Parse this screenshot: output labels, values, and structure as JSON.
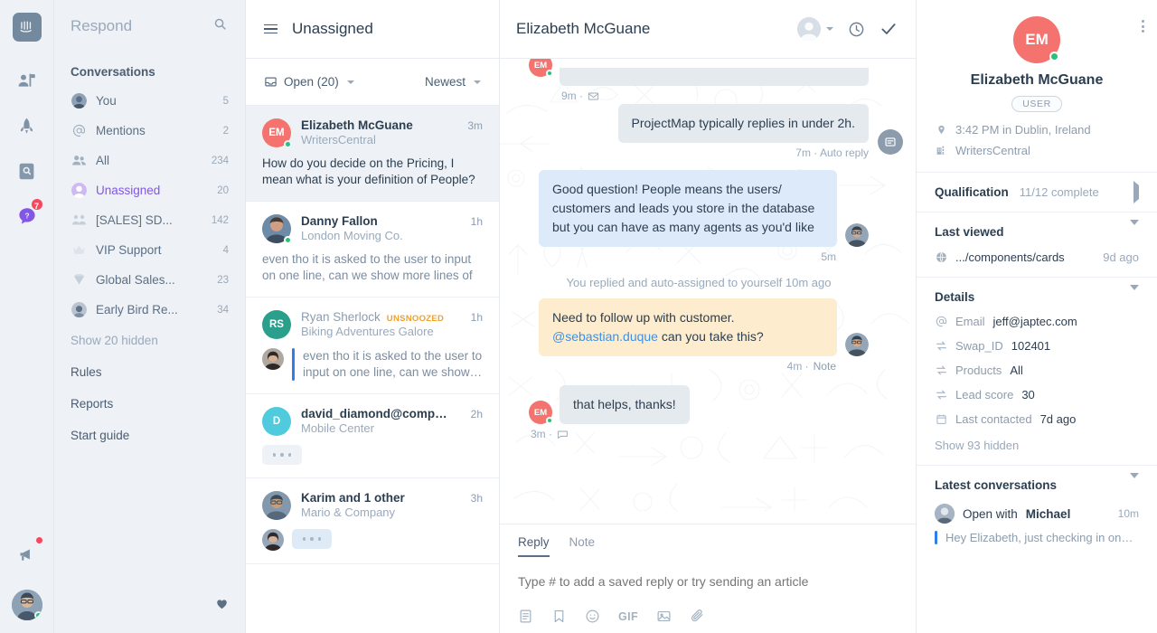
{
  "rail": {
    "logo_icon": "intercom-logo-icon",
    "items": [
      {
        "icon": "platform-people-icon",
        "name": "platform"
      },
      {
        "icon": "rocket-icon",
        "name": "outbound"
      },
      {
        "icon": "knowledge-base-icon",
        "name": "articles"
      },
      {
        "icon": "respond-question-bubble-icon",
        "name": "respond",
        "badge": "7"
      }
    ],
    "megaphone_icon": "megaphone-icon",
    "user_avatar": "current-user-avatar"
  },
  "sidebar": {
    "title": "Respond",
    "search_icon": "search-icon",
    "section_label": "Conversations",
    "items": [
      {
        "label": "You",
        "count": "5",
        "icon": "user-avatar-icon"
      },
      {
        "label": "Mentions",
        "count": "2",
        "icon": "at-mention-icon"
      },
      {
        "label": "All",
        "count": "234",
        "icon": "people-icon"
      },
      {
        "label": "Unassigned",
        "count": "20",
        "icon": "unassigned-person-icon",
        "active": true
      },
      {
        "label": "[SALES] SD...",
        "count": "142",
        "icon": "team-icon"
      },
      {
        "label": "VIP Support",
        "count": "4",
        "icon": "crown-icon"
      },
      {
        "label": "Global Sales...",
        "count": "23",
        "icon": "diamond-icon"
      },
      {
        "label": "Early Bird Re...",
        "count": "34",
        "icon": "bird-icon"
      }
    ],
    "show_hidden": "Show 20 hidden",
    "links": [
      "Rules",
      "Reports",
      "Start guide"
    ],
    "favorite_icon": "heart-icon"
  },
  "list": {
    "menu_icon": "hamburger-menu-icon",
    "title": "Unassigned",
    "status_filter": "Open (20)",
    "status_icon": "inbox-icon",
    "sort_filter": "Newest",
    "conversations": [
      {
        "initials": "EM",
        "avatar_color": "#f4736e",
        "name": "Elizabeth McGuane",
        "company": "WritersCentral",
        "time": "3m",
        "preview": "How do you decide on the Pricing, I mean what is your definition of People? When…",
        "selected": true,
        "online": true,
        "type": "text"
      },
      {
        "initials": "",
        "avatar_color": "#6d8aa6",
        "name": "Danny Fallon",
        "company": "London Moving Co.",
        "time": "1h",
        "preview": "even tho it is asked to the user to input on one line, can we show more lines of text…",
        "selected": false,
        "online": true,
        "type": "text",
        "photo": true
      },
      {
        "initials": "RS",
        "avatar_color": "#2aa08c",
        "name": "Ryan Sherlock",
        "company": "Biking Adventures Galore",
        "time": "1h",
        "badge": "UNSNOOZED",
        "preview": "even tho it is asked to the user to input on one line, can we show…",
        "selected": false,
        "muted": true,
        "type": "agent-reply"
      },
      {
        "initials": "D",
        "avatar_color": "#4fcbdd",
        "name": "david_diamond@comp…",
        "company": "Mobile Center",
        "time": "2h",
        "type": "typing"
      },
      {
        "initials": "",
        "avatar_color": "#8198ad",
        "name": "Karim and 1 other",
        "company": "Mario & Company",
        "time": "3h",
        "type": "typing-with-avatar",
        "photo": true
      }
    ]
  },
  "pane": {
    "title": "Elizabeth McGuane",
    "assignee_icon": "assignee-avatar-icon",
    "snooze_icon": "clock-snooze-icon",
    "close_icon": "checkmark-close-icon",
    "side_button_icon": "conversation-details-icon",
    "messages": [
      {
        "side": "left",
        "style": "grey",
        "text": "",
        "stamp": "9m ·",
        "stamp_icon": "email-icon",
        "truncated": true
      },
      {
        "side": "right",
        "style": "grey",
        "text": "ProjectMap typically replies in under 2h.",
        "stamp": "7m · Auto reply"
      },
      {
        "side": "right",
        "style": "blue",
        "text": "Good question! People means the users/ customers and leads you store in the database but you can have as many agents as you'd like",
        "stamp": "5m",
        "avatar": true
      },
      {
        "side": "system",
        "text": "You replied and auto-assigned to yourself 10m ago"
      },
      {
        "side": "right",
        "style": "note",
        "text_before": "Need to follow up with customer. ",
        "mention": "@sebastian.duque",
        "text_after": " can you take this?",
        "stamp": "4m ·",
        "stamp_note": "Note",
        "avatar": true
      },
      {
        "side": "left",
        "style": "grey",
        "text": "that helps, thanks!",
        "stamp": "3m ·",
        "stamp_icon": "chat-icon",
        "em_avatar": true
      }
    ]
  },
  "composer": {
    "tabs": [
      {
        "label": "Reply",
        "active": true
      },
      {
        "label": "Note",
        "active": false
      }
    ],
    "placeholder": "Type # to add a saved reply or try sending an article",
    "value": "",
    "tools": [
      {
        "icon": "saved-reply-icon",
        "label": ""
      },
      {
        "icon": "bookmark-article-icon",
        "label": ""
      },
      {
        "icon": "emoji-icon",
        "label": ""
      },
      {
        "icon": "gif-icon",
        "label": "GIF"
      },
      {
        "icon": "image-icon",
        "label": ""
      },
      {
        "icon": "attachment-paperclip-icon",
        "label": ""
      }
    ]
  },
  "details": {
    "kebab_icon": "more-options-icon",
    "initials": "EM",
    "avatar_color": "#f4736e",
    "name": "Elizabeth McGuane",
    "role_pill": "USER",
    "location": "3:42 PM in Dublin, Ireland",
    "location_icon": "location-pin-icon",
    "company": "WritersCentral",
    "company_icon": "building-icon",
    "qualification": {
      "label": "Qualification",
      "progress": "11/12 complete",
      "arrow_icon": "chevron-right-icon"
    },
    "last_viewed": {
      "label": "Last viewed",
      "arrow_icon": "chevron-down-icon",
      "page": ".../components/cards",
      "page_icon": "globe-icon",
      "time": "9d ago"
    },
    "details_section": {
      "label": "Details",
      "arrow_icon": "chevron-down-icon",
      "rows": [
        {
          "icon": "at-sign-icon",
          "key": "Email",
          "value": "jeff@japtec.com"
        },
        {
          "icon": "swap-icon",
          "key": "Swap_ID",
          "value": "102401"
        },
        {
          "icon": "swap-icon",
          "key": "Products",
          "value": "All"
        },
        {
          "icon": "swap-icon",
          "key": "Lead score",
          "value": "30"
        },
        {
          "icon": "calendar-icon",
          "key": "Last contacted",
          "value": "7d ago"
        }
      ],
      "show_hidden": "Show 93 hidden"
    },
    "latest_conversations": {
      "label": "Latest conversations",
      "arrow_icon": "chevron-down-icon",
      "items": [
        {
          "prefix": "Open with ",
          "person": "Michael",
          "time": "10m",
          "preview": "Hey Elizabeth, just checking in on…"
        }
      ]
    }
  },
  "colors": {
    "accent_purple": "#8257e6",
    "blue_bubble": "#dceafa",
    "note_bubble": "#fdeccd",
    "grey_bubble": "#e5eaef",
    "unsnoozed_orange": "#f0a12e",
    "online_green": "#29c07a",
    "red_badge": "#f5485f"
  }
}
